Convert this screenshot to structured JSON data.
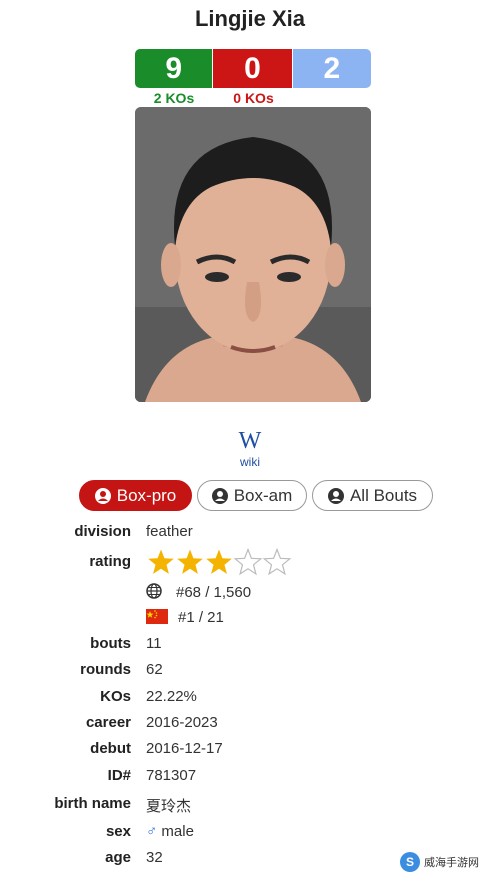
{
  "fighter": {
    "name": "Lingjie Xia"
  },
  "record": {
    "wins": "9",
    "losses": "0",
    "draws": "2",
    "wins_kos": "2 KOs",
    "losses_kos": "0 KOs"
  },
  "wiki": {
    "symbol": "W",
    "label": "wiki"
  },
  "tabs": [
    {
      "label": "Box-pro",
      "active": true
    },
    {
      "label": "Box-am",
      "active": false
    },
    {
      "label": "All Bouts",
      "active": false
    }
  ],
  "details": {
    "division_label": "division",
    "division_value": "feather",
    "rating_label": "rating",
    "rating_stars": 3,
    "rating_max": 5,
    "world_rank": "#68 / 1,560",
    "country_rank": "#1 / 21",
    "bouts_label": "bouts",
    "bouts_value": "11",
    "rounds_label": "rounds",
    "rounds_value": "62",
    "kos_label": "KOs",
    "kos_value": "22.22%",
    "career_label": "career",
    "career_value": "2016-2023",
    "debut_label": "debut",
    "debut_value": "2016-12-17",
    "id_label": "ID#",
    "id_value": "781307",
    "birthname_label": "birth name",
    "birthname_value": "夏玲杰",
    "sex_label": "sex",
    "sex_symbol": "♂",
    "sex_value": "male",
    "age_label": "age",
    "age_value": "32"
  },
  "watermark": {
    "text": "威海手游网",
    "logo_letter": "S"
  },
  "colors": {
    "win": "#1a8c2a",
    "loss": "#cc1616",
    "draw": "#8db4f2",
    "star": "#f5b301"
  },
  "icons": {
    "tab_icon": "user-circle-icon",
    "globe": "globe-icon",
    "flag": "china-flag-icon"
  }
}
